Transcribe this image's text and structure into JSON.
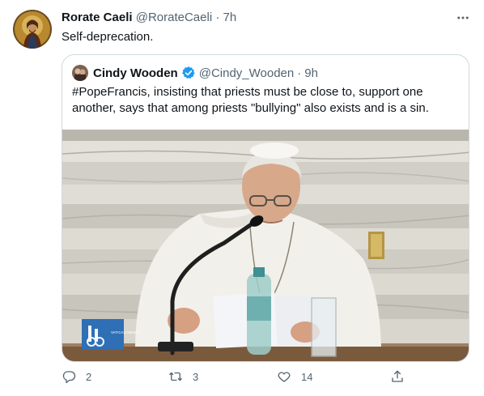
{
  "tweet": {
    "author_name": "Rorate Caeli",
    "handle": "@RorateCaeli",
    "separator": "·",
    "time": "7h",
    "text": "Self-deprecation.",
    "more_icon": "more-horizontal-icon"
  },
  "quoted": {
    "author_name": "Cindy Wooden",
    "handle": "@Cindy_Wooden",
    "separator": "·",
    "time": "9h",
    "verified_color": "#1d9bf0",
    "text": "#PopeFrancis, insisting that priests must be close to, support one another, says that among priests \"bullying\" also exists and is a sin.",
    "media": {
      "logo_text": "VATICAN MEDIA"
    }
  },
  "actions": {
    "reply_count": "2",
    "retweet_count": "3",
    "like_count": "14"
  },
  "colors": {
    "text": "#0f1419",
    "secondary": "#536471",
    "border": "#cfd9de"
  }
}
